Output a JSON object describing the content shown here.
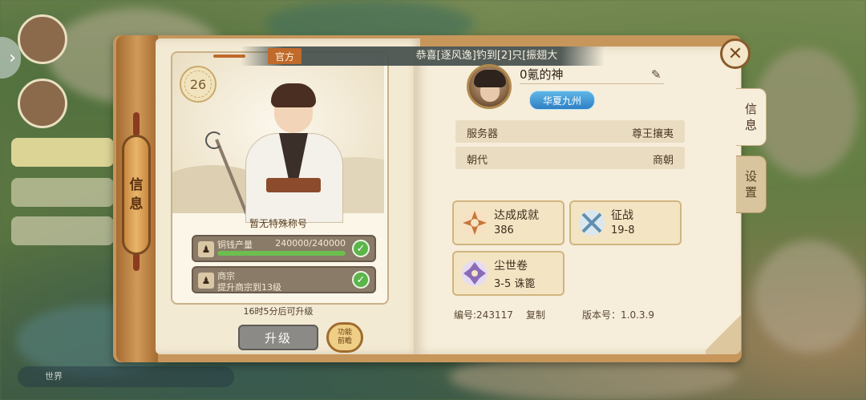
{
  "banner": {
    "tag": "官方",
    "message": "恭喜[逐风逸]钓到[2]只[振翅大"
  },
  "left_tab": {
    "label_1": "信",
    "label_2": "息"
  },
  "card": {
    "level": "26",
    "title": "暂无特殊称号",
    "copper": {
      "label": "铜钱产量",
      "value": "240000/240000",
      "progress": 1.0
    },
    "sect": {
      "label": "商宗",
      "sub": "提升商宗到13级"
    },
    "upgrade_hint": "16时5分后可升级",
    "upgrade_button": "升级",
    "preview_button_1": "功能",
    "preview_button_2": "前瞻"
  },
  "profile": {
    "name": "0氪的神",
    "region": "华夏九州",
    "server_key": "服务器",
    "server_val": "尊王攘夷",
    "dynasty_key": "朝代",
    "dynasty_val": "商朝"
  },
  "achievements": [
    {
      "title": "达成成就",
      "value": "386",
      "icon": "sunburst-icon",
      "color": "#c8763a"
    },
    {
      "title": "征战",
      "value": "19-8",
      "icon": "crossed-swords-icon",
      "color": "#5f8fb0"
    },
    {
      "title": "尘世卷",
      "value": "3-5 诛篦",
      "icon": "purple-emblem-icon",
      "color": "#8a6bb8"
    }
  ],
  "footer": {
    "id_label": "编号:243117",
    "copy": "复制",
    "version": "版本号：1.0.3.9"
  },
  "side_tabs": [
    {
      "line1": "信",
      "line2": "息",
      "active": true
    },
    {
      "line1": "设",
      "line2": "置",
      "active": false
    }
  ],
  "background": {
    "chat_placeholder": "世界"
  }
}
